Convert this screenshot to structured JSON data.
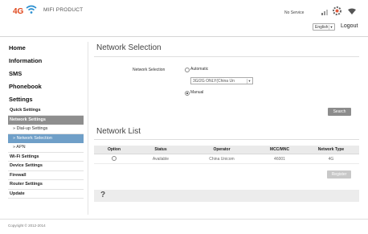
{
  "header": {
    "logo_text": "4G",
    "product": "MIFI PRODUCT",
    "status": "No Service",
    "language": "English",
    "logout": "Logout"
  },
  "sidebar": {
    "top_items": [
      {
        "label": "Home"
      },
      {
        "label": "Information"
      },
      {
        "label": "SMS"
      },
      {
        "label": "Phonebook"
      },
      {
        "label": "Settings"
      }
    ],
    "sub_items": [
      {
        "label": "Quick Settings"
      },
      {
        "label": "Network Settings"
      },
      {
        "label": "» Dial-up Settings"
      },
      {
        "label": "» Network Selection"
      },
      {
        "label": "» APN"
      },
      {
        "label": "Wi-Fi Settings"
      },
      {
        "label": "Device Settings"
      },
      {
        "label": "Firewall"
      },
      {
        "label": "Router Settings"
      },
      {
        "label": "Update"
      }
    ]
  },
  "main": {
    "network_selection_title": "Network Selection",
    "field_label": "Network Selection",
    "option_auto": "Automatic",
    "mode_select_value": "3G/2G ONLY(China Un",
    "option_manual": "Manual",
    "search_button": "Search",
    "network_list_title": "Network List",
    "table": {
      "headers": [
        "Option",
        "Status",
        "Operator",
        "MCC/MNC",
        "Network Type"
      ],
      "rows": [
        {
          "status": "Available",
          "operator": "China Unicom",
          "mccmnc": "46001",
          "type": "4G"
        }
      ]
    },
    "register_button": "Register",
    "help_icon": "?"
  },
  "footer": {
    "copyright": "Copyright © 2012-2014"
  },
  "colors": {
    "brand": "#e0471c",
    "active_dark": "#8e8e8e",
    "active_blue": "#6f9fc8"
  }
}
